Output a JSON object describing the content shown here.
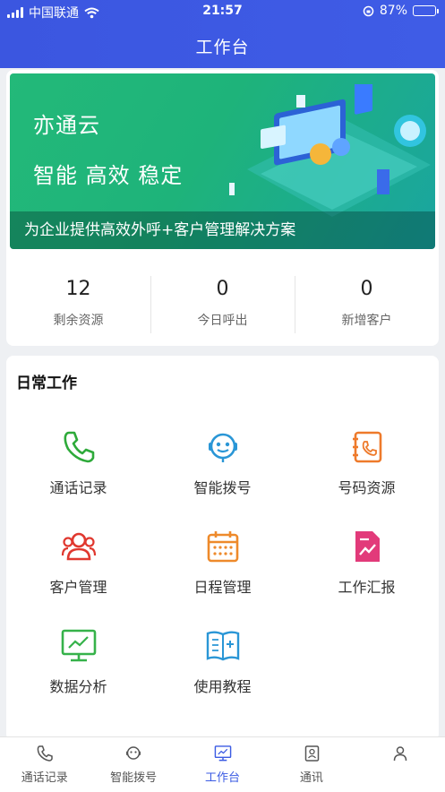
{
  "status_bar": {
    "carrier": "中国联通",
    "time": "21:57",
    "battery": "87%",
    "battery_level": 0.87
  },
  "header": {
    "title": "工作台"
  },
  "banner": {
    "title": "亦通云",
    "slogan": "智能 高效 稳定",
    "caption": "为企业提供高效外呼+客户管理解决方案"
  },
  "stats": [
    {
      "value": "12",
      "label": "剩余资源"
    },
    {
      "value": "0",
      "label": "今日呼出"
    },
    {
      "value": "0",
      "label": "新增客户"
    }
  ],
  "daily_work": {
    "title": "日常工作",
    "items": [
      {
        "label": "通话记录",
        "icon": "phone-icon",
        "color": "#2eaa3a"
      },
      {
        "label": "智能拨号",
        "icon": "headset-robot-icon",
        "color": "#2a96d6"
      },
      {
        "label": "号码资源",
        "icon": "number-book-icon",
        "color": "#ee7a2b"
      },
      {
        "label": "客户管理",
        "icon": "customers-icon",
        "color": "#e0382f"
      },
      {
        "label": "日程管理",
        "icon": "calendar-icon",
        "color": "#ee8a2b"
      },
      {
        "label": "工作汇报",
        "icon": "report-icon",
        "color": "#e23a7a"
      },
      {
        "label": "数据分析",
        "icon": "chart-monitor-icon",
        "color": "#36b24a"
      },
      {
        "label": "使用教程",
        "icon": "book-icon",
        "color": "#2a96d6"
      }
    ]
  },
  "tabs": [
    {
      "label": "通话记录",
      "icon": "phone-icon"
    },
    {
      "label": "智能拨号",
      "icon": "headset-robot-icon"
    },
    {
      "label": "工作台",
      "icon": "monitor-icon",
      "active": true
    },
    {
      "label": "通讯",
      "icon": "contacts-icon"
    },
    {
      "label": "",
      "icon": "user-icon"
    }
  ],
  "colors": {
    "header": "#3b56e0",
    "accent": "#3b5be3",
    "banner": "#23b979"
  }
}
